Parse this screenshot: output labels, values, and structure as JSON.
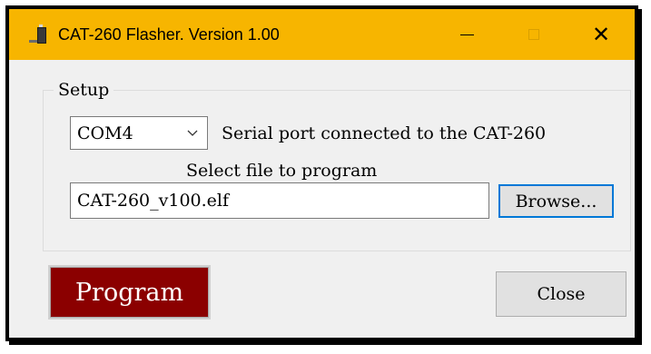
{
  "window": {
    "title": "CAT-260 Flasher.  Version 1.00",
    "icon": "chip-programmer-icon",
    "titlebar_color": "#f7b500",
    "controls": {
      "minimize": "minimize-icon",
      "maximize": "maximize-icon",
      "close": "✕"
    }
  },
  "setup": {
    "legend": "Setup",
    "port": {
      "selected": "COM4",
      "caret_icon": "chevron-down-icon",
      "label": "Serial port connected to the CAT-260"
    },
    "file": {
      "label": "Select file to program",
      "value": "CAT-260_v100.elf",
      "browse_label": "Browse..."
    }
  },
  "actions": {
    "program_label": "Program",
    "program_color": "#8b0000",
    "close_label": "Close"
  }
}
